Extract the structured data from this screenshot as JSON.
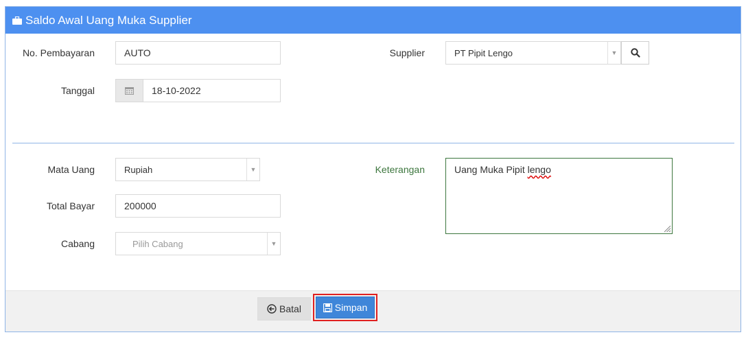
{
  "header": {
    "title": "Saldo Awal Uang Muka Supplier",
    "icon": "briefcase-icon"
  },
  "form": {
    "no_pembayaran": {
      "label": "No. Pembayaran",
      "value": "AUTO"
    },
    "tanggal": {
      "label": "Tanggal",
      "value": "18-10-2022",
      "icon": "calendar-icon"
    },
    "supplier": {
      "label": "Supplier",
      "value": "PT Pipit Lengo",
      "search_icon": "search-icon"
    },
    "mata_uang": {
      "label": "Mata Uang",
      "value": "Rupiah"
    },
    "total_bayar": {
      "label": "Total Bayar",
      "value": "200000"
    },
    "cabang": {
      "label": "Cabang",
      "placeholder": "Pilih Cabang"
    },
    "keterangan": {
      "label": "Keterangan",
      "value_start": "Uang Muka Pipit ",
      "value_misspelled": "lengo"
    }
  },
  "footer": {
    "batal_label": "Batal",
    "simpan_label": "Simpan"
  },
  "colors": {
    "header_bg": "#4d90f0",
    "primary_button": "#3f86d9",
    "highlight_border": "#e02020",
    "keterangan_label": "#3c763d"
  }
}
